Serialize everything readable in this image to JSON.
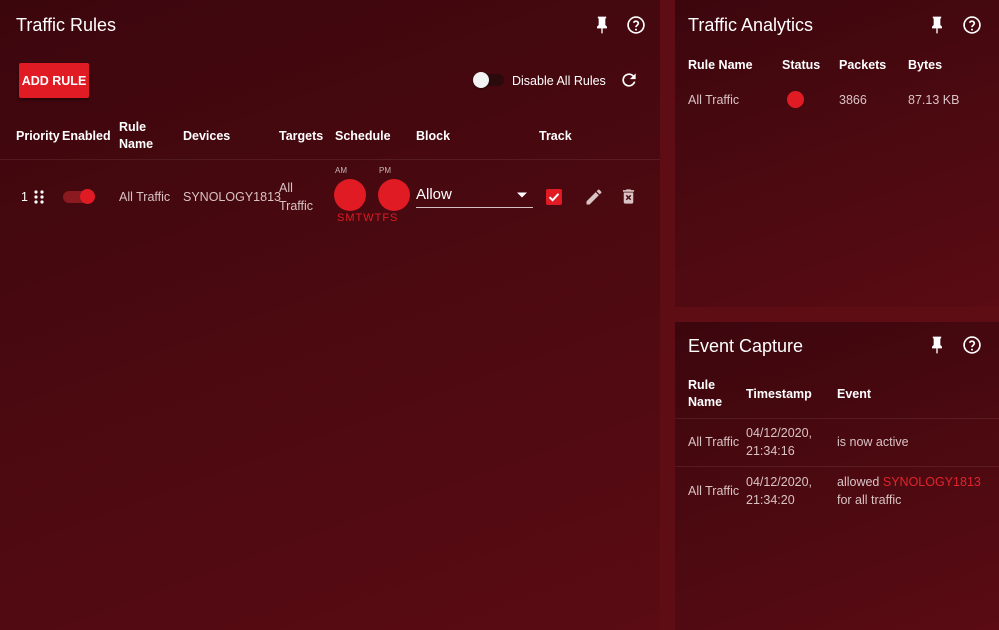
{
  "rules": {
    "title": "Traffic Rules",
    "add_rule_label": "ADD RULE",
    "disable_all_label": "Disable All Rules",
    "columns": {
      "priority": "Priority",
      "enabled": "Enabled",
      "rule_name_1": "Rule",
      "rule_name_2": "Name",
      "devices": "Devices",
      "targets": "Targets",
      "schedule": "Schedule",
      "block": "Block",
      "track": "Track"
    },
    "row": {
      "priority": "1",
      "enabled": true,
      "rule_name": "All Traffic",
      "device": "SYNOLOGY1813",
      "targets_1": "All",
      "targets_2": "Traffic",
      "schedule_am": "AM",
      "schedule_pm": "PM",
      "schedule_days": "SMTWTFS",
      "block_value": "Allow",
      "track": true
    }
  },
  "analytics": {
    "title": "Traffic Analytics",
    "columns": {
      "rule_name": "Rule Name",
      "status": "Status",
      "packets": "Packets",
      "bytes": "Bytes"
    },
    "row": {
      "rule_name": "All Traffic",
      "packets": "3866",
      "bytes": "87.13 KB"
    }
  },
  "events": {
    "title": "Event Capture",
    "columns": {
      "rule_name_1": "Rule",
      "rule_name_2": "Name",
      "timestamp": "Timestamp",
      "event": "Event"
    },
    "rows": [
      {
        "rule_name": "All Traffic",
        "date": "04/12/2020,",
        "time": "21:34:16",
        "event": "is now active"
      },
      {
        "rule_name": "All Traffic",
        "date": "04/12/2020,",
        "time": "21:34:20",
        "event_prefix": "allowed",
        "event_device": "SYNOLOGY1813",
        "event_suffix": "for all traffic"
      }
    ]
  },
  "colors": {
    "accent": "#e01b24",
    "background": "#5e0d14",
    "panel": "#4a0910",
    "muted_text": "#d9c3c5"
  },
  "icons": [
    "pin-icon",
    "help-icon",
    "refresh-icon",
    "drag-handle-icon",
    "edit-icon",
    "delete-icon",
    "dropdown-arrow-icon",
    "checkmark-icon"
  ]
}
